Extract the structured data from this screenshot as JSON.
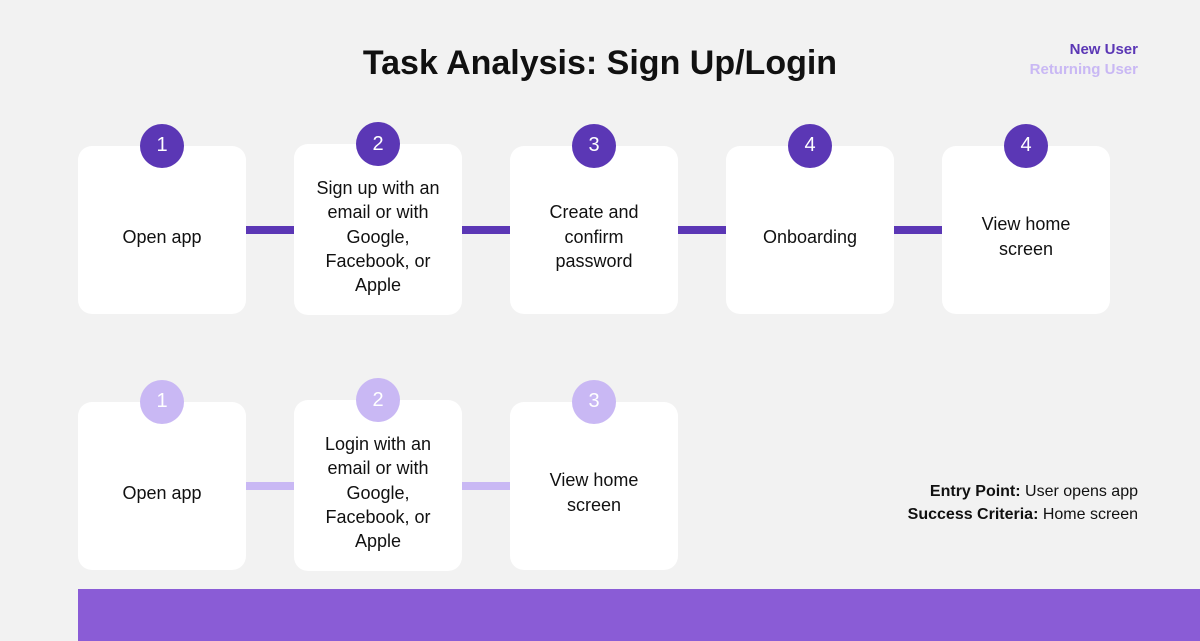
{
  "title": "Task Analysis: Sign Up/Login",
  "legend": {
    "newUser": "New User",
    "returningUser": "Returning User"
  },
  "colors": {
    "primary": "#5b37b5",
    "light": "#c9b8f4",
    "footer": "#8a5cd6"
  },
  "newUserFlow": [
    {
      "num": "1",
      "text": "Open app"
    },
    {
      "num": "2",
      "text": "Sign up with an email or with Google, Facebook, or Apple"
    },
    {
      "num": "3",
      "text": "Create and confirm password"
    },
    {
      "num": "4",
      "text": "Onboarding"
    },
    {
      "num": "4",
      "text": "View home screen"
    }
  ],
  "returningUserFlow": [
    {
      "num": "1",
      "text": "Open app"
    },
    {
      "num": "2",
      "text": "Login with an email or with Google, Facebook, or Apple"
    },
    {
      "num": "3",
      "text": "View home screen"
    }
  ],
  "notes": {
    "entryLabel": "Entry Point:",
    "entryValue": " User opens app",
    "successLabel": "Success Criteria:",
    "successValue": " Home screen"
  }
}
